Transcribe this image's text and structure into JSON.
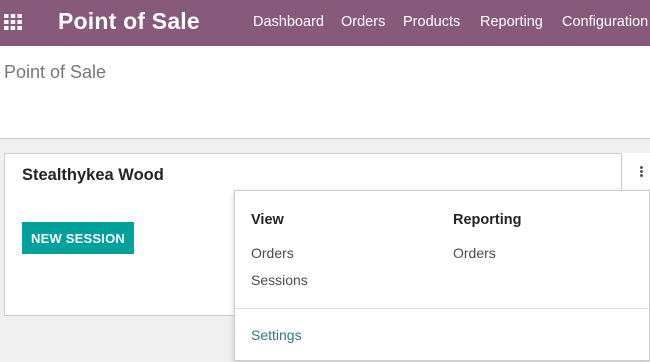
{
  "navbar": {
    "app_title": "Point of Sale",
    "menu": [
      "Dashboard",
      "Orders",
      "Products",
      "Reporting",
      "Configuration"
    ],
    "color": "#875a7b"
  },
  "control_panel": {
    "breadcrumb": "Point of Sale"
  },
  "kanban": {
    "card": {
      "title": "Stealthykea Wood",
      "primary_button": "NEW SESSION",
      "button_color": "#00a09d"
    }
  },
  "dropdown": {
    "view": {
      "heading": "View",
      "items": [
        "Orders",
        "Sessions"
      ]
    },
    "reporting": {
      "heading": "Reporting",
      "items": [
        "Orders"
      ]
    },
    "settings_label": "Settings"
  }
}
